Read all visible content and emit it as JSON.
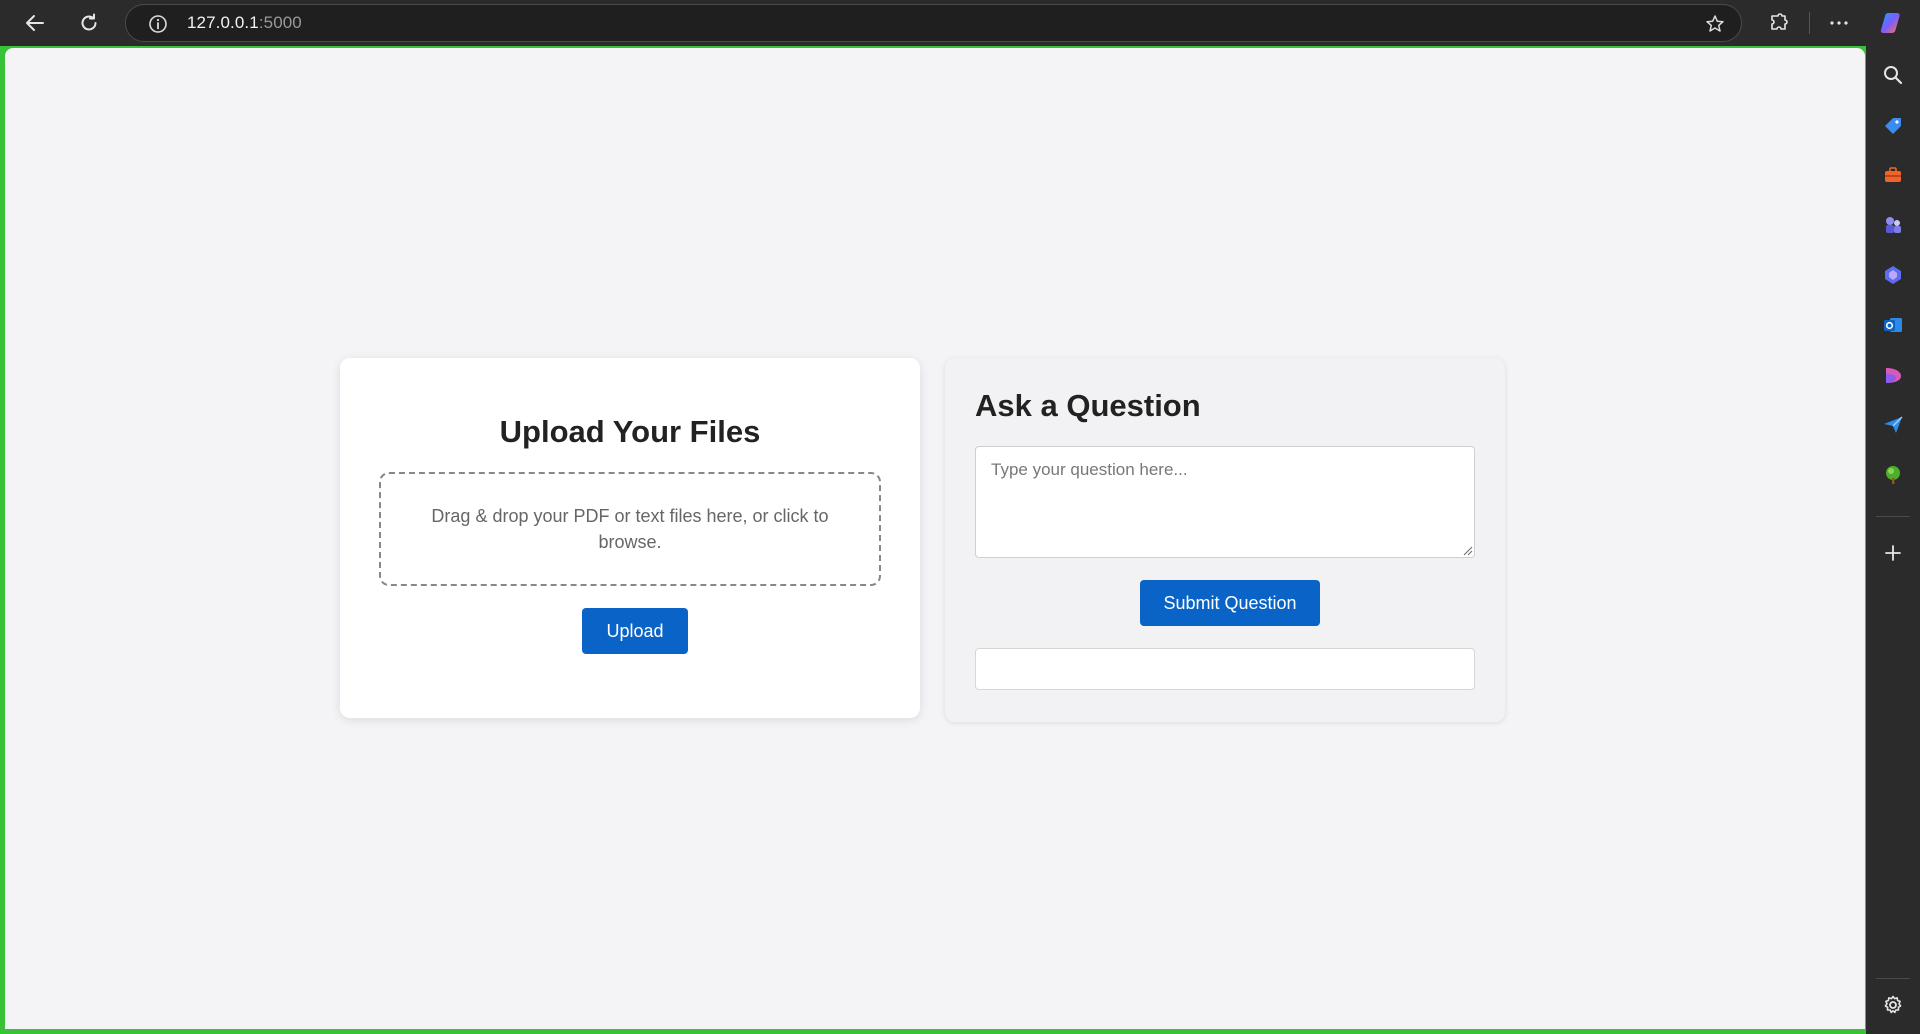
{
  "browser": {
    "url_host": "127.0.0.1",
    "url_port": ":5000",
    "toolbar_icons": [
      "back-icon",
      "refresh-icon",
      "info-icon",
      "favorite-star-icon",
      "extensions-icon",
      "more-icon",
      "copilot-icon"
    ],
    "sidebar_icons": [
      "search-icon",
      "shopping-tag-icon",
      "tools-icon",
      "games-icon",
      "copilot-app-icon",
      "outlook-icon",
      "designer-icon",
      "send-icon",
      "tree-icon",
      "add-icon",
      "settings-icon"
    ]
  },
  "upload": {
    "title": "Upload Your Files",
    "dropzone_text": "Drag & drop your PDF or text files here, or click to browse.",
    "button_label": "Upload"
  },
  "ask": {
    "title": "Ask a Question",
    "placeholder": "Type your question here...",
    "button_label": "Submit Question",
    "answer": ""
  },
  "colors": {
    "accent": "#0a63c6",
    "window_border": "#38c238",
    "chrome": "#2b2b2b",
    "page_bg": "#f4f4f7"
  }
}
